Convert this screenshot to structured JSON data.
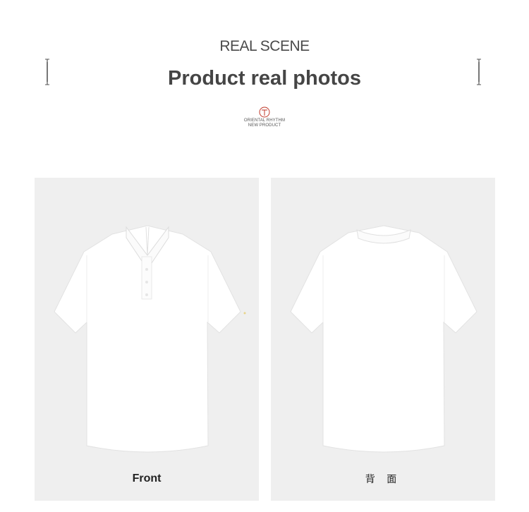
{
  "header": {
    "subtitle": "REAL SCENE",
    "title": "Product real photos",
    "brand_line1": "ORIENTAL RHYTHM",
    "brand_line2": "NEW PRODUCT"
  },
  "panels": [
    {
      "caption": "Front"
    },
    {
      "caption": "背 面"
    }
  ],
  "colors": {
    "panel_bg": "#efefef",
    "title": "#454545",
    "brand_accent": "#c0392b"
  }
}
